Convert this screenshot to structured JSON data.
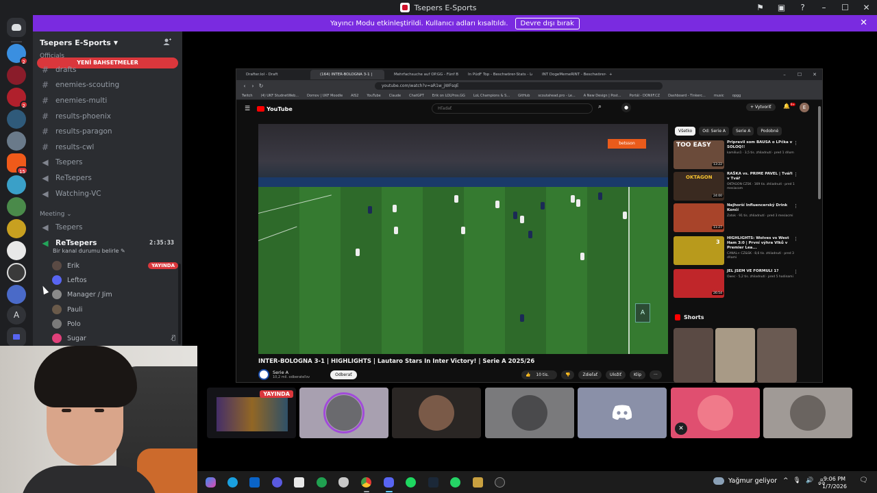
{
  "window": {
    "title": "Tsepers E-Sports",
    "controls": [
      "–",
      "☐",
      "✕"
    ]
  },
  "banner": {
    "text": "Yayıncı Modu etkinleştirildi. Kullanıcı adları kısaltıldı.",
    "button": "Devre dışı bırak"
  },
  "rail": {
    "badges": [
      "2",
      "2",
      "15"
    ],
    "letter": "A"
  },
  "sidebar": {
    "server_name": "Tsepers E-Sports",
    "category_officials": "Officials",
    "new_mentions": "YENİ BAHSETMELER",
    "channels": [
      {
        "name": "drafts",
        "type": "text"
      },
      {
        "name": "enemies-scouting",
        "type": "text"
      },
      {
        "name": "enemies-multi",
        "type": "text"
      },
      {
        "name": "results-phoenix",
        "type": "text"
      },
      {
        "name": "results-paragon",
        "type": "text"
      },
      {
        "name": "results-cwl",
        "type": "text"
      },
      {
        "name": "Tsepers",
        "type": "voice"
      },
      {
        "name": "ReTsepers",
        "type": "voice"
      },
      {
        "name": "Watching-VC",
        "type": "voice"
      }
    ],
    "category_meeting": "Meeting",
    "meeting_channels": [
      {
        "name": "Tsepers",
        "type": "voice"
      },
      {
        "name": "ReTsepers",
        "type": "voice",
        "timer": "2:35:33",
        "status": "Bir kanal durumu belirle"
      }
    ],
    "members": [
      {
        "name": "Erik",
        "badge": "YAYINDA"
      },
      {
        "name": "Leftos"
      },
      {
        "name": "Manager / Jim"
      },
      {
        "name": "Pauli"
      },
      {
        "name": "Polo"
      },
      {
        "name": "Sugar"
      }
    ]
  },
  "browser": {
    "tabs": [
      "Drafter.lol - Draft",
      "(164) INTER-BOLOGNA 3-1 |",
      "Mehrfachsuche auf OP.GG - Fünf Bü",
      "In PüdF Top - Beschwörer-Stats - Le",
      "INT DogeMemeRINT - Beschwörer-St"
    ],
    "url": "youtube.com/watch?v=aR1w_jWFsqE",
    "bookmarks": [
      "Twitch",
      "(4) UKF StudnetWeb...",
      "Domov | UKF Moodle",
      "AIS2",
      "YouTube",
      "Claude",
      "ChatGPT",
      "Erik on LOLPros.GG",
      "LoL Champions & S...",
      "GitHub",
      "scoutahead.pro - Le...",
      "A New Design | Post...",
      "Portál - DONIIF.CZ",
      "Dashboard - Tinkerc...",
      "music",
      "opgg"
    ]
  },
  "youtube": {
    "logo": "YouTube",
    "search_placeholder": "Hľadať",
    "create": "Vytvoriť",
    "notif_count": "9+",
    "avatar_letter": "E",
    "video_title": "INTER-BOLOGNA 3-1 | HIGHLIGHTS | Lautaro Stars In Inter Victory! | Serie A 2025/26",
    "channel": "Serie A",
    "subscribers": "10,2 mil. odberateľov",
    "subscribe": "Odberať",
    "actions": [
      "10 tis.",
      "Zdieľať",
      "Uložiť",
      "Klip",
      "···"
    ],
    "ad_text": "betsson",
    "chips": [
      "Všetko",
      "Od: Serie A",
      "Serie A",
      "Podobné"
    ],
    "recommendations": [
      {
        "title": "Pripravil som BAUSA o LPčka v SOLOQ!!",
        "meta": "kamilius1 · 3,5 tis. zhliadnutí · pred 1 dňom",
        "duration": "13:22",
        "thumb_text": "TOO EASY",
        "color": "#6b4b3a"
      },
      {
        "title": "RAŠKA vs. PRIME PAVEL | Tváři v Tvář",
        "meta": "OKTAGON CZSK · 169 tis. zhliadnutí · pred 1 mesiacom",
        "duration": "24:00",
        "thumb_text": "OKTAGON",
        "color": "#3a2a20"
      },
      {
        "title": "Nejhorší Influencerský Drink Končí",
        "meta": "Zatok · 91 tis. zhliadnutí · pred 3 mesiacmi",
        "duration": "11:27",
        "thumb_text": "",
        "color": "#a8442a"
      },
      {
        "title": "HIGHLIGHTS: Wolves vs West Ham 3:0 | První výhra Vlků v Premier Lea...",
        "meta": "CANAL+ CZ&SK · 8,6 tis. zhliadnutí · pred 3 dňami",
        "duration": "",
        "thumb_text": "3",
        "color": "#b89a1c"
      },
      {
        "title": "JEL JSEM VE FORMULI 1?",
        "meta": "Owec · 5,2 tis. zhliadnutí · pred 5 hodinami",
        "duration": "26:54",
        "thumb_text": "",
        "color": "#c0262a"
      }
    ],
    "shorts_label": "Shorts",
    "shorts_colors": [
      "#5a4a44",
      "#a89a86",
      "#6a5a52"
    ]
  },
  "tiles": [
    {
      "type": "stream",
      "badge": "YAYINDA"
    },
    {
      "type": "avatar"
    },
    {
      "type": "camera"
    },
    {
      "type": "avatar"
    },
    {
      "type": "discord"
    },
    {
      "type": "avatar-muted"
    },
    {
      "type": "avatar"
    }
  ],
  "taskbar": {
    "weather": "Yağmur geliyor",
    "time": "9:06 PM",
    "date": "1/7/2026",
    "tray": [
      "^",
      "🎙",
      "🔊",
      "🖧"
    ]
  },
  "colors": {
    "banner": "#7a2be0",
    "live_red": "#da373c",
    "sidebar_bg": "#2b2d31",
    "rail_bg": "#1e1f22",
    "youtube_red": "#ff0000",
    "blurple": "#5865f2"
  }
}
